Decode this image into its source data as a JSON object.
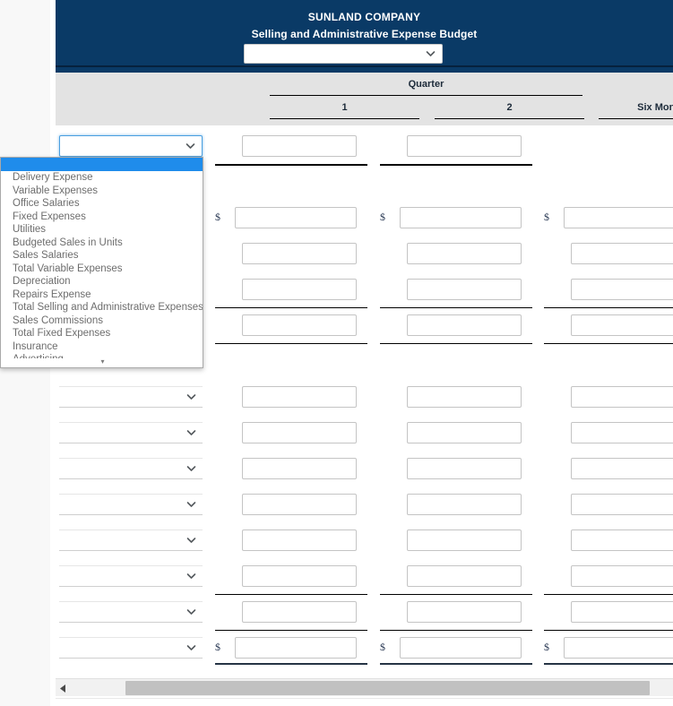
{
  "header": {
    "company": "SUNLAND COMPANY",
    "report_title": "Selling and Administrative Expense Budget",
    "period_select": {
      "value": "",
      "name": "period-select"
    }
  },
  "columns": {
    "group_label": "Quarter",
    "q1": "1",
    "q2": "2",
    "six_months": "Six Months"
  },
  "symbols": {
    "dollar": "$",
    "chevron_down": "⌄",
    "scroll_left": "◀",
    "scroll_down": "▾"
  },
  "dropdown": {
    "open": true,
    "selected": "",
    "options": [
      "",
      "Delivery Expense",
      "Variable Expenses",
      "Office Salaries",
      "Fixed Expenses",
      "Utilities",
      "Budgeted Sales in Units",
      "Sales Salaries",
      "Total Variable Expenses",
      "Depreciation",
      "Repairs Expense",
      "Total Selling and Administrative Expenses",
      "Sales Commissions",
      "Total Fixed Expenses",
      "Insurance",
      "Advertising"
    ]
  },
  "rows": [
    {
      "label_select": "",
      "q1": "",
      "q2": "",
      "six": null,
      "dollar": false
    },
    {
      "label_select": "",
      "q1": "",
      "q2": "",
      "six": "",
      "dollar": true
    },
    {
      "label_select": "",
      "q1": "",
      "q2": "",
      "six": "",
      "dollar": false
    },
    {
      "label_select": "",
      "q1": "",
      "q2": "",
      "six": "",
      "dollar": false
    },
    {
      "label_select": "",
      "q1": "",
      "q2": "",
      "six": "",
      "dollar": false
    },
    {
      "label_select": "",
      "q1": "",
      "q2": "",
      "six": "",
      "dollar": false
    },
    {
      "label_select": "",
      "q1": "",
      "q2": "",
      "six": "",
      "dollar": false
    },
    {
      "label_select": "",
      "q1": "",
      "q2": "",
      "six": "",
      "dollar": false
    },
    {
      "label_select": "",
      "q1": "",
      "q2": "",
      "six": "",
      "dollar": false
    },
    {
      "label_select": "",
      "q1": "",
      "q2": "",
      "six": "",
      "dollar": false
    },
    {
      "label_select": "",
      "q1": "",
      "q2": "",
      "six": "",
      "dollar": false
    },
    {
      "label_select": "",
      "q1": "",
      "q2": "",
      "six": "",
      "dollar": false
    },
    {
      "label_select": "",
      "q1": "",
      "q2": "",
      "six": "",
      "dollar": true
    }
  ],
  "colors": {
    "navy": "#0a3a66",
    "navy_dark": "#06213d",
    "header_gray": "#e3e3e3",
    "highlight_blue": "#1f8ceb",
    "focus_blue": "#4a9fe0",
    "gutter": "#f8f8f8",
    "scroll_thumb": "#c1c1c1"
  },
  "scrollbar": {
    "orientation": "horizontal",
    "position_pct": 2
  }
}
